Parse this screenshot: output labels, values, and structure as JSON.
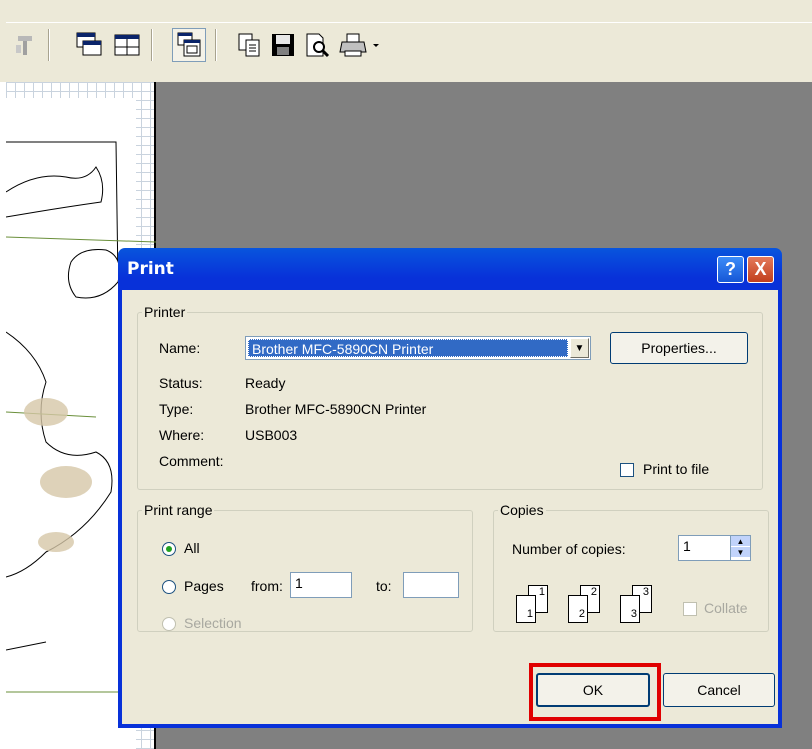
{
  "toolbar": {
    "icons": [
      "tools-icon",
      "tile-horizontal-icon",
      "tile-grid-icon",
      "cascade-windows-icon",
      "copy-page-icon",
      "save-icon",
      "print-preview-icon",
      "printer-icon",
      "dropdown-arrow-icon"
    ]
  },
  "dialog": {
    "title": "Print",
    "help_glyph": "?",
    "close_glyph": "X",
    "printer": {
      "legend": "Printer",
      "name_label": "Name:",
      "name_value": "Brother MFC-5890CN Printer",
      "properties_label": "Properties...",
      "status_label": "Status:",
      "status_value": "Ready",
      "type_label": "Type:",
      "type_value": "Brother MFC-5890CN Printer",
      "where_label": "Where:",
      "where_value": "USB003",
      "comment_label": "Comment:",
      "print_to_file_label": "Print to file"
    },
    "print_range": {
      "legend": "Print range",
      "all_label": "All",
      "pages_label": "Pages",
      "from_label": "from:",
      "from_value": "1",
      "to_label": "to:",
      "to_value": "",
      "selection_label": "Selection"
    },
    "copies": {
      "legend": "Copies",
      "number_label": "Number of copies:",
      "number_value": "1",
      "collate_label": "Collate",
      "page_digits": [
        "1",
        "1",
        "2",
        "2",
        "3",
        "3"
      ]
    },
    "ok_label": "OK",
    "cancel_label": "Cancel"
  },
  "colors": {
    "title_bar": "#0831d9",
    "dialog_face": "#ece9d8",
    "selection": "#316ac5",
    "highlight_box": "#e00000",
    "workspace": "#808080"
  }
}
